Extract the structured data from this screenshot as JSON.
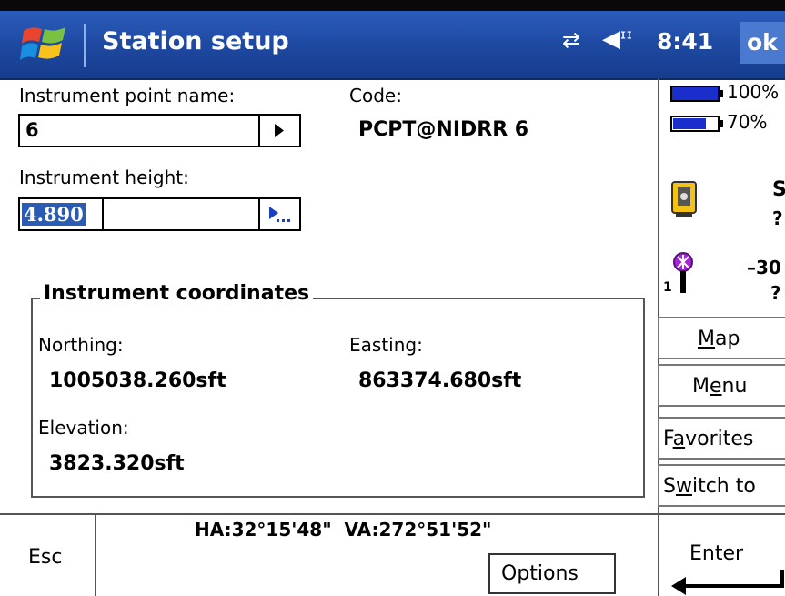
{
  "titlebar": {
    "title": "Station setup",
    "time": "8:41",
    "ok_label": "ok",
    "icons": [
      "windows-start-icon",
      "connectivity-icon",
      "volume-icon"
    ]
  },
  "form": {
    "instrument_point_label": "Instrument point name:",
    "instrument_point_value": "6",
    "code_label": "Code:",
    "code_value": "PCPT@NIDRR 6",
    "instrument_height_label": "Instrument height:",
    "instrument_height_value": "4.890"
  },
  "coordinates": {
    "group_label": "Instrument coordinates",
    "northing_label": "Northing:",
    "northing_value": "1005038.260sft",
    "easting_label": "Easting:",
    "easting_value": "863374.680sft",
    "elevation_label": "Elevation:",
    "elevation_value": "3823.320sft"
  },
  "status_panel": {
    "battery1": "100%",
    "battery2": "70%",
    "instrument_status": "S",
    "instrument_q": "?",
    "prism_value": "–30",
    "prism_q": "?",
    "prism_index": "1"
  },
  "side_buttons": {
    "map": {
      "pre": "",
      "u": "M",
      "post": "ap"
    },
    "menu": {
      "pre": "M",
      "u": "e",
      "post": "nu"
    },
    "favorites": {
      "pre": "F",
      "u": "a",
      "post": "vorites"
    },
    "switch": {
      "pre": "S",
      "u": "w",
      "post": "itch to"
    }
  },
  "bottom": {
    "esc_label": "Esc",
    "angles": "HA:32°15'48\"  VA:272°51'52\"",
    "options_label": "Options",
    "enter_label": "Enter"
  },
  "colors": {
    "titlebar": "#1f4aa3",
    "selection": "#2a5bb5",
    "battery": "#1a2ecc"
  }
}
